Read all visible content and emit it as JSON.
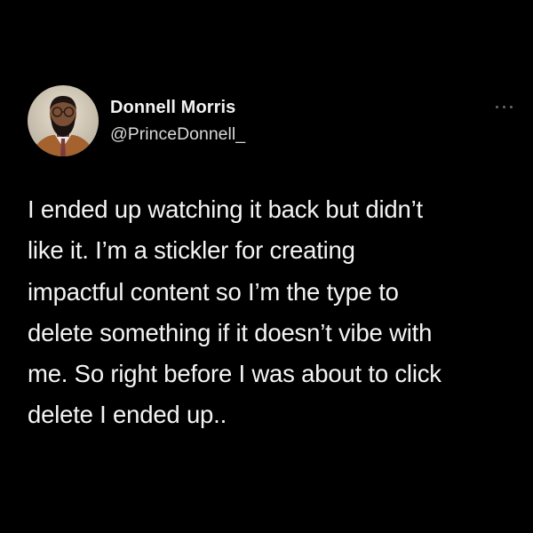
{
  "tweet": {
    "author": {
      "display_name": "Donnell Morris",
      "handle": "@PrinceDonnell_",
      "avatar_icon": "profile-photo"
    },
    "more_icon": "more-horizontal-icon",
    "text_lines": [
      "I ended up watching it back but didn’t",
      "like it. I’m a stickler for creating",
      "impactful content so I’m the type to",
      "delete something if it doesn’t vibe with",
      "me. So right before I was about to click",
      "delete I ended up.."
    ]
  },
  "colors": {
    "background": "#000000",
    "text": "#f4f4f4",
    "secondary_text": "#d8d8d8",
    "icon_gray": "#6a6a6a"
  }
}
